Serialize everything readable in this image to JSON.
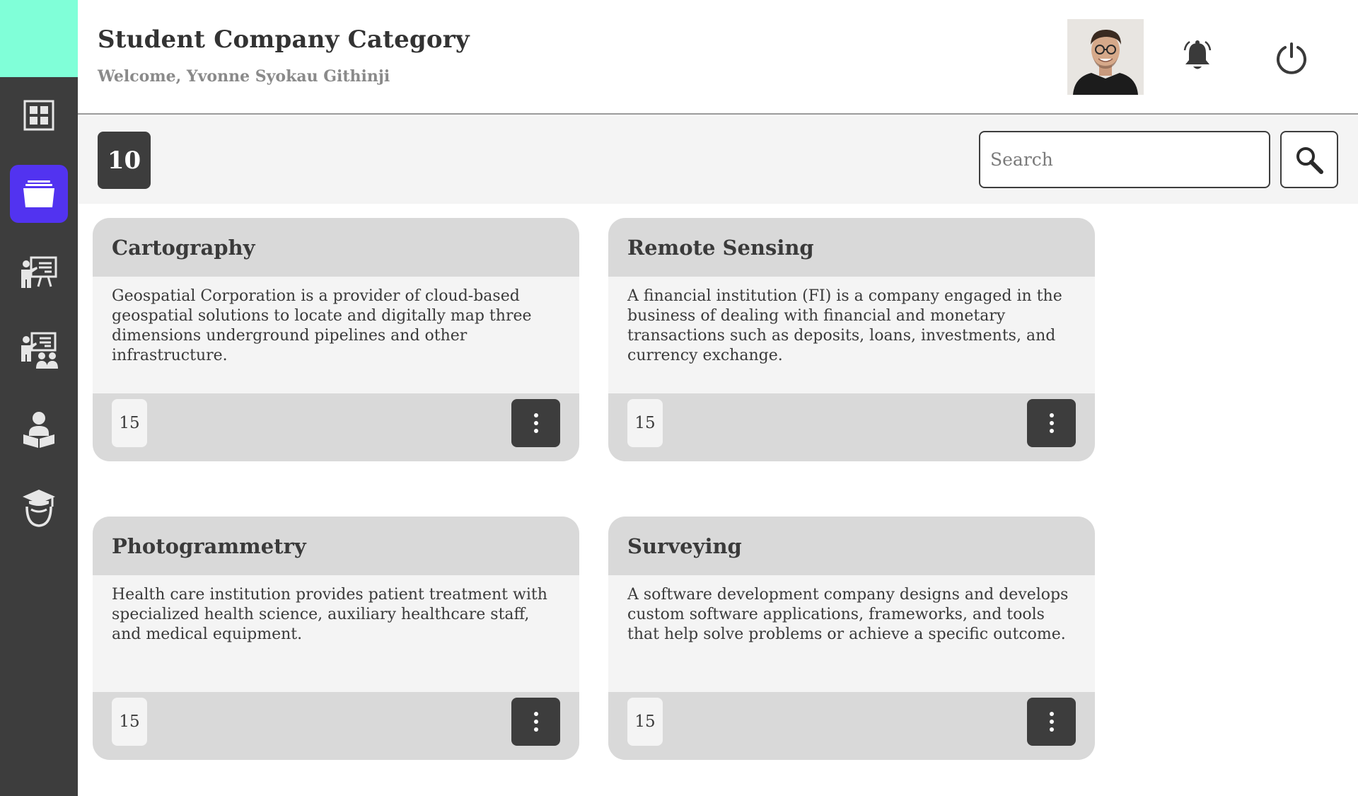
{
  "header": {
    "title": "Student Company Category",
    "welcome": "Welcome, Yvonne Syokau Githinji"
  },
  "sidebar": {
    "items": [
      {
        "icon": "dashboard-icon",
        "active": false
      },
      {
        "icon": "folder-icon",
        "active": true
      },
      {
        "icon": "teacher-board-icon",
        "active": false
      },
      {
        "icon": "classroom-icon",
        "active": false
      },
      {
        "icon": "student-reading-icon",
        "active": false
      },
      {
        "icon": "graduate-icon",
        "active": false
      }
    ]
  },
  "toolbar": {
    "count": "10",
    "search_placeholder": "Search"
  },
  "cards": [
    {
      "title": "Cartography",
      "description": "Geospatial Corporation is a provider of cloud-based geospatial solutions to locate and digitally map three dimensions underground pipelines and other infrastructure.",
      "count": "15"
    },
    {
      "title": "Remote Sensing",
      "description": "A financial institution (FI) is a company engaged in the business of dealing with financial and monetary transactions such as deposits, loans, investments, and currency exchange.",
      "count": "15"
    },
    {
      "title": "Photogrammetry",
      "description": "Health care institution provides patient treatment with specialized health science, auxiliary healthcare staff, and medical equipment.",
      "count": "15"
    },
    {
      "title": "Surveying",
      "description": "A software development company designs and develops custom software applications, frameworks, and tools that help solve problems or achieve a specific outcome.",
      "count": "15"
    }
  ],
  "colors": {
    "sidebar": "#3d3d3d",
    "logo_block": "#80ffd8",
    "active_nav": "#5233f0",
    "card_header": "#d9d9d9",
    "card_body": "#f4f4f4"
  }
}
